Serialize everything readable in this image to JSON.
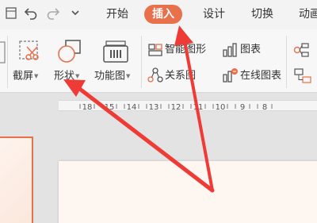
{
  "quick_access": {
    "undo_icon": "undo-icon",
    "redo_icon": "redo-icon",
    "more_icon": "chevron-down-icon"
  },
  "tabs": [
    {
      "label": "开始",
      "active": false
    },
    {
      "label": "插入",
      "active": true
    },
    {
      "label": "设计",
      "active": false
    },
    {
      "label": "切换",
      "active": false
    },
    {
      "label": "动画",
      "active": false
    }
  ],
  "ribbon": {
    "screenshot_label": "截屏",
    "shapes_label": "形状",
    "function_chart_label": "功能图",
    "smart_graphic_label": "智能图形",
    "chart_label": "图表",
    "relationship_label": "关系图",
    "online_chart_label": "在线图表"
  },
  "ruler": {
    "ticks": [
      "18",
      "15",
      "14",
      "13",
      "12",
      "11",
      "10",
      "9",
      "8"
    ]
  },
  "colors": {
    "accent": "#e8704a",
    "arrow": "#ee3b36"
  }
}
